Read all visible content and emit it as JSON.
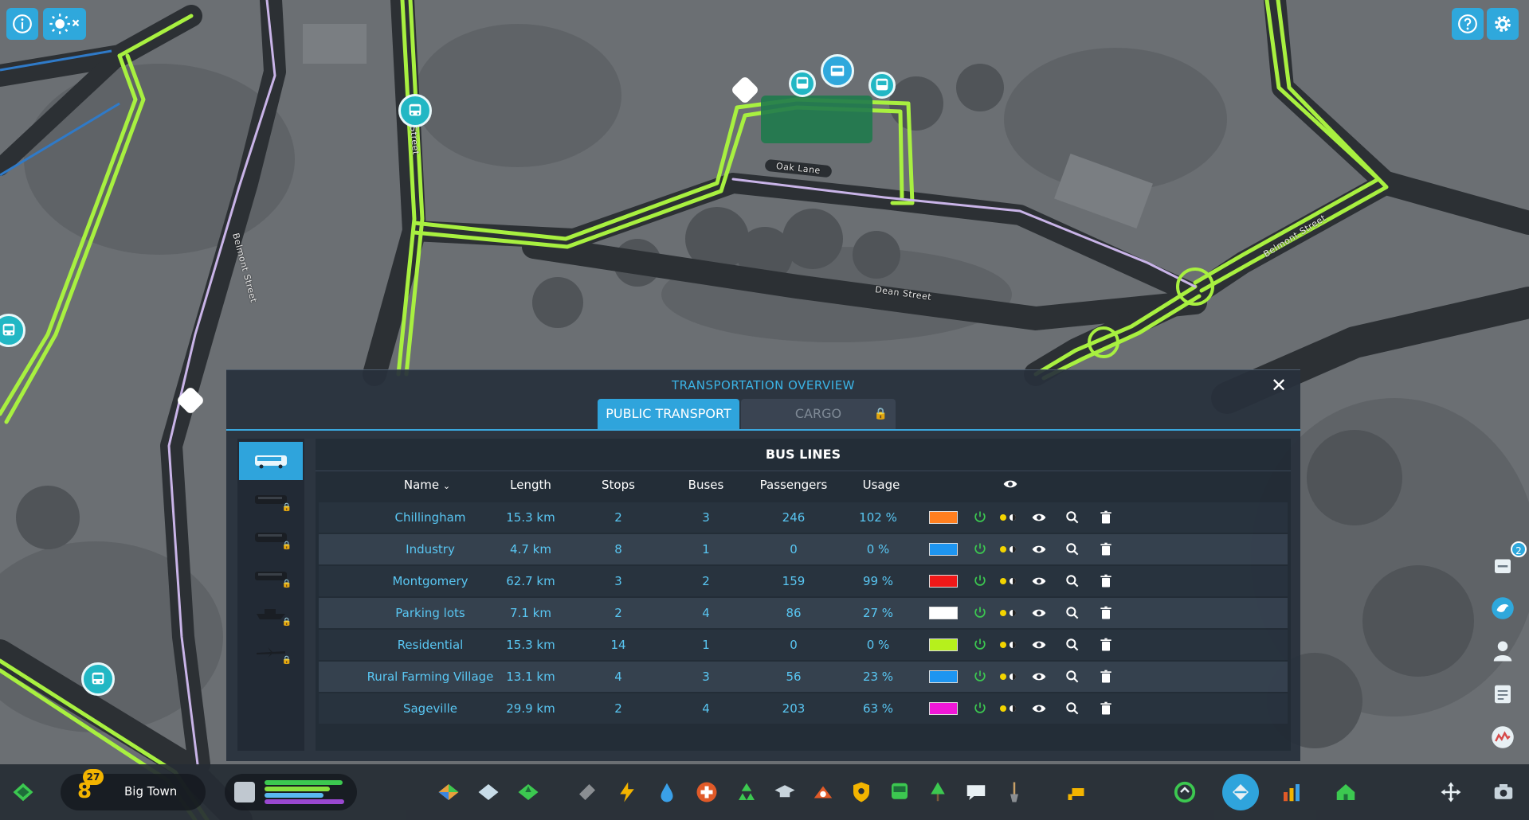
{
  "map": {
    "street_labels": [
      "Oak Lane",
      "Dean Street",
      "Belmont Street",
      "Belmont Street",
      "Street"
    ]
  },
  "top_left": {
    "info_icon": "info-icon",
    "weather_icon": "sun-off-icon"
  },
  "top_right": {
    "help_icon": "help-icon",
    "settings_icon": "gear-icon"
  },
  "panel": {
    "title": "TRANSPORTATION OVERVIEW",
    "close": "✕",
    "tabs": [
      {
        "label": "PUBLIC TRANSPORT",
        "active": true
      },
      {
        "label": "CARGO",
        "locked": true
      }
    ],
    "side_items": [
      "bus",
      "tram",
      "train",
      "subway",
      "ship",
      "airplane"
    ],
    "content_title": "BUS LINES",
    "columns": {
      "name": "Name",
      "length": "Length",
      "stops": "Stops",
      "buses": "Buses",
      "passengers": "Passengers",
      "usage": "Usage"
    },
    "rows": [
      {
        "name": "Chillingham",
        "length": "15.3 km",
        "stops": "2",
        "buses": "3",
        "passengers": "246",
        "usage": "102 %",
        "color": "#ff7f1f"
      },
      {
        "name": "Industry",
        "length": "4.7 km",
        "stops": "8",
        "buses": "1",
        "passengers": "0",
        "usage": "0 %",
        "color": "#1e95f0"
      },
      {
        "name": "Montgomery",
        "length": "62.7 km",
        "stops": "3",
        "buses": "2",
        "passengers": "159",
        "usage": "99 %",
        "color": "#f01818"
      },
      {
        "name": "Parking lots",
        "length": "7.1 km",
        "stops": "2",
        "buses": "4",
        "passengers": "86",
        "usage": "27 %",
        "color": "#ffffff"
      },
      {
        "name": "Residential",
        "length": "15.3 km",
        "stops": "14",
        "buses": "1",
        "passengers": "0",
        "usage": "0 %",
        "color": "#b6f01c"
      },
      {
        "name": "Rural Farming Village",
        "length": "13.1 km",
        "stops": "4",
        "buses": "3",
        "passengers": "56",
        "usage": "23 %",
        "color": "#1e95f0"
      },
      {
        "name": "Sageville",
        "length": "29.9 km",
        "stops": "2",
        "buses": "4",
        "passengers": "203",
        "usage": "63 %",
        "color": "#f018d8"
      }
    ]
  },
  "bottom_bar": {
    "city_level": "8",
    "city_level_badge": "27",
    "city_name": "Big Town",
    "stat_bars": [
      {
        "color": "#3cc850",
        "value": 0.98
      },
      {
        "color": "#86e040",
        "value": 0.82
      },
      {
        "color": "#5ab8f0",
        "value": 0.74
      },
      {
        "color": "#9a48d0",
        "value": 1.0
      }
    ]
  },
  "right_side": {
    "notification_count": "2"
  },
  "colors": {
    "accent": "#2fa4dc",
    "panel_title": "#3bb4e6",
    "row_text": "#59c6f2",
    "lock": "#f3b400",
    "road_line": "#a8f040"
  }
}
